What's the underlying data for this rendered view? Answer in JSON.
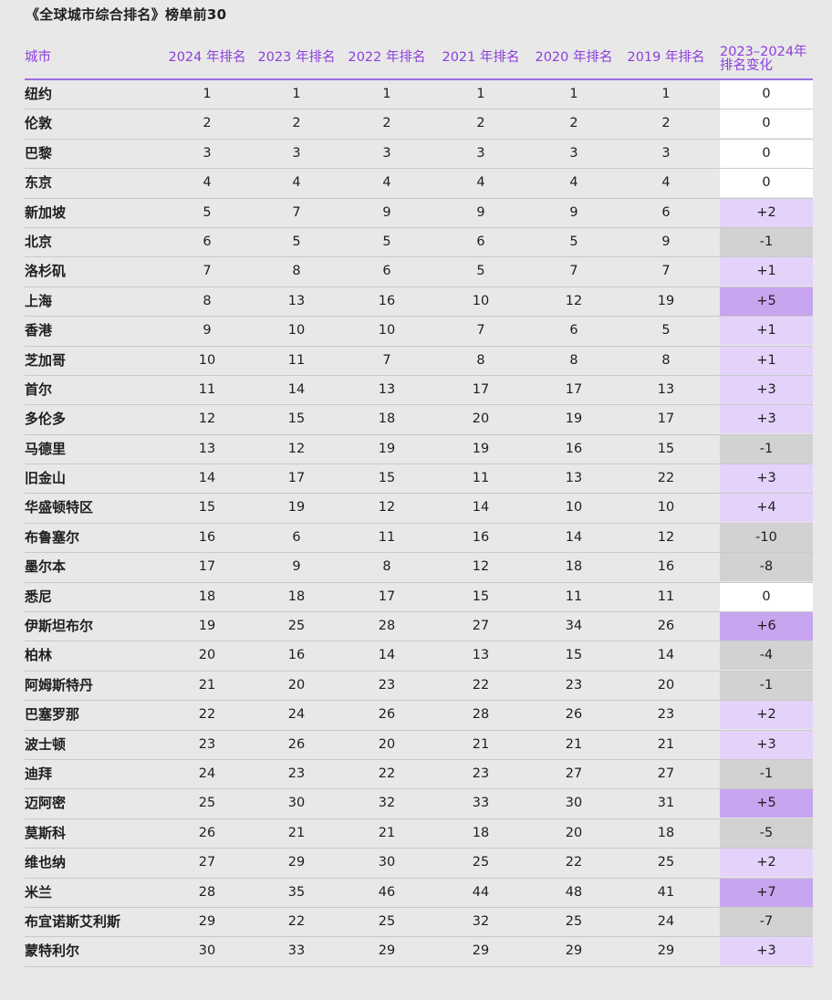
{
  "title": "《全球城市综合排名》榜单前30",
  "headers": {
    "city": "城市",
    "y2024": "2024 年排名",
    "y2023": "2023 年排名",
    "y2022": "2022 年排名",
    "y2021": "2021 年排名",
    "y2020": "2020 年排名",
    "y2019": "2019 年排名",
    "change": "2023–2024年排名变化"
  },
  "colors": {
    "header_text": "#8d3fdb",
    "header_rule": "#9b6ee0",
    "change_zero": "#ffffff",
    "change_negative": "#d2d2d2",
    "change_small_positive": "#e4d2fb",
    "change_large_positive": "#c8a5ef"
  },
  "rows": [
    {
      "city": "纽约",
      "r2024": "1",
      "r2023": "1",
      "r2022": "1",
      "r2021": "1",
      "r2020": "1",
      "r2019": "1",
      "change": "0"
    },
    {
      "city": "伦敦",
      "r2024": "2",
      "r2023": "2",
      "r2022": "2",
      "r2021": "2",
      "r2020": "2",
      "r2019": "2",
      "change": "0"
    },
    {
      "city": "巴黎",
      "r2024": "3",
      "r2023": "3",
      "r2022": "3",
      "r2021": "3",
      "r2020": "3",
      "r2019": "3",
      "change": "0"
    },
    {
      "city": "东京",
      "r2024": "4",
      "r2023": "4",
      "r2022": "4",
      "r2021": "4",
      "r2020": "4",
      "r2019": "4",
      "change": "0"
    },
    {
      "city": "新加坡",
      "r2024": "5",
      "r2023": "7",
      "r2022": "9",
      "r2021": "9",
      "r2020": "9",
      "r2019": "6",
      "change": "+2"
    },
    {
      "city": "北京",
      "r2024": "6",
      "r2023": "5",
      "r2022": "5",
      "r2021": "6",
      "r2020": "5",
      "r2019": "9",
      "change": "-1"
    },
    {
      "city": "洛杉矶",
      "r2024": "7",
      "r2023": "8",
      "r2022": "6",
      "r2021": "5",
      "r2020": "7",
      "r2019": "7",
      "change": "+1"
    },
    {
      "city": "上海",
      "r2024": "8",
      "r2023": "13",
      "r2022": "16",
      "r2021": "10",
      "r2020": "12",
      "r2019": "19",
      "change": "+5"
    },
    {
      "city": "香港",
      "r2024": "9",
      "r2023": "10",
      "r2022": "10",
      "r2021": "7",
      "r2020": "6",
      "r2019": "5",
      "change": "+1"
    },
    {
      "city": "芝加哥",
      "r2024": "10",
      "r2023": "11",
      "r2022": "7",
      "r2021": "8",
      "r2020": "8",
      "r2019": "8",
      "change": "+1"
    },
    {
      "city": "首尔",
      "r2024": "11",
      "r2023": "14",
      "r2022": "13",
      "r2021": "17",
      "r2020": "17",
      "r2019": "13",
      "change": "+3"
    },
    {
      "city": "多伦多",
      "r2024": "12",
      "r2023": "15",
      "r2022": "18",
      "r2021": "20",
      "r2020": "19",
      "r2019": "17",
      "change": "+3"
    },
    {
      "city": "马德里",
      "r2024": "13",
      "r2023": "12",
      "r2022": "19",
      "r2021": "19",
      "r2020": "16",
      "r2019": "15",
      "change": "-1"
    },
    {
      "city": "旧金山",
      "r2024": "14",
      "r2023": "17",
      "r2022": "15",
      "r2021": "11",
      "r2020": "13",
      "r2019": "22",
      "change": "+3"
    },
    {
      "city": "华盛顿特区",
      "r2024": "15",
      "r2023": "19",
      "r2022": "12",
      "r2021": "14",
      "r2020": "10",
      "r2019": "10",
      "change": "+4"
    },
    {
      "city": "布鲁塞尔",
      "r2024": "16",
      "r2023": "6",
      "r2022": "11",
      "r2021": "16",
      "r2020": "14",
      "r2019": "12",
      "change": "-10"
    },
    {
      "city": "墨尔本",
      "r2024": "17",
      "r2023": "9",
      "r2022": "8",
      "r2021": "12",
      "r2020": "18",
      "r2019": "16",
      "change": "-8"
    },
    {
      "city": "悉尼",
      "r2024": "18",
      "r2023": "18",
      "r2022": "17",
      "r2021": "15",
      "r2020": "11",
      "r2019": "11",
      "change": "0"
    },
    {
      "city": "伊斯坦布尔",
      "r2024": "19",
      "r2023": "25",
      "r2022": "28",
      "r2021": "27",
      "r2020": "34",
      "r2019": "26",
      "change": "+6"
    },
    {
      "city": "柏林",
      "r2024": "20",
      "r2023": "16",
      "r2022": "14",
      "r2021": "13",
      "r2020": "15",
      "r2019": "14",
      "change": "-4"
    },
    {
      "city": "阿姆斯特丹",
      "r2024": "21",
      "r2023": "20",
      "r2022": "23",
      "r2021": "22",
      "r2020": "23",
      "r2019": "20",
      "change": "-1"
    },
    {
      "city": "巴塞罗那",
      "r2024": "22",
      "r2023": "24",
      "r2022": "26",
      "r2021": "28",
      "r2020": "26",
      "r2019": "23",
      "change": "+2"
    },
    {
      "city": "波士顿",
      "r2024": "23",
      "r2023": "26",
      "r2022": "20",
      "r2021": "21",
      "r2020": "21",
      "r2019": "21",
      "change": "+3"
    },
    {
      "city": "迪拜",
      "r2024": "24",
      "r2023": "23",
      "r2022": "22",
      "r2021": "23",
      "r2020": "27",
      "r2019": "27",
      "change": "-1"
    },
    {
      "city": "迈阿密",
      "r2024": "25",
      "r2023": "30",
      "r2022": "32",
      "r2021": "33",
      "r2020": "30",
      "r2019": "31",
      "change": "+5"
    },
    {
      "city": "莫斯科",
      "r2024": "26",
      "r2023": "21",
      "r2022": "21",
      "r2021": "18",
      "r2020": "20",
      "r2019": "18",
      "change": "-5"
    },
    {
      "city": "维也纳",
      "r2024": "27",
      "r2023": "29",
      "r2022": "30",
      "r2021": "25",
      "r2020": "22",
      "r2019": "25",
      "change": "+2"
    },
    {
      "city": "米兰",
      "r2024": "28",
      "r2023": "35",
      "r2022": "46",
      "r2021": "44",
      "r2020": "48",
      "r2019": "41",
      "change": "+7"
    },
    {
      "city": "布宜诺斯艾利斯",
      "r2024": "29",
      "r2023": "22",
      "r2022": "25",
      "r2021": "32",
      "r2020": "25",
      "r2019": "24",
      "change": "-7"
    },
    {
      "city": "蒙特利尔",
      "r2024": "30",
      "r2023": "33",
      "r2022": "29",
      "r2021": "29",
      "r2020": "29",
      "r2019": "29",
      "change": "+3"
    }
  ]
}
